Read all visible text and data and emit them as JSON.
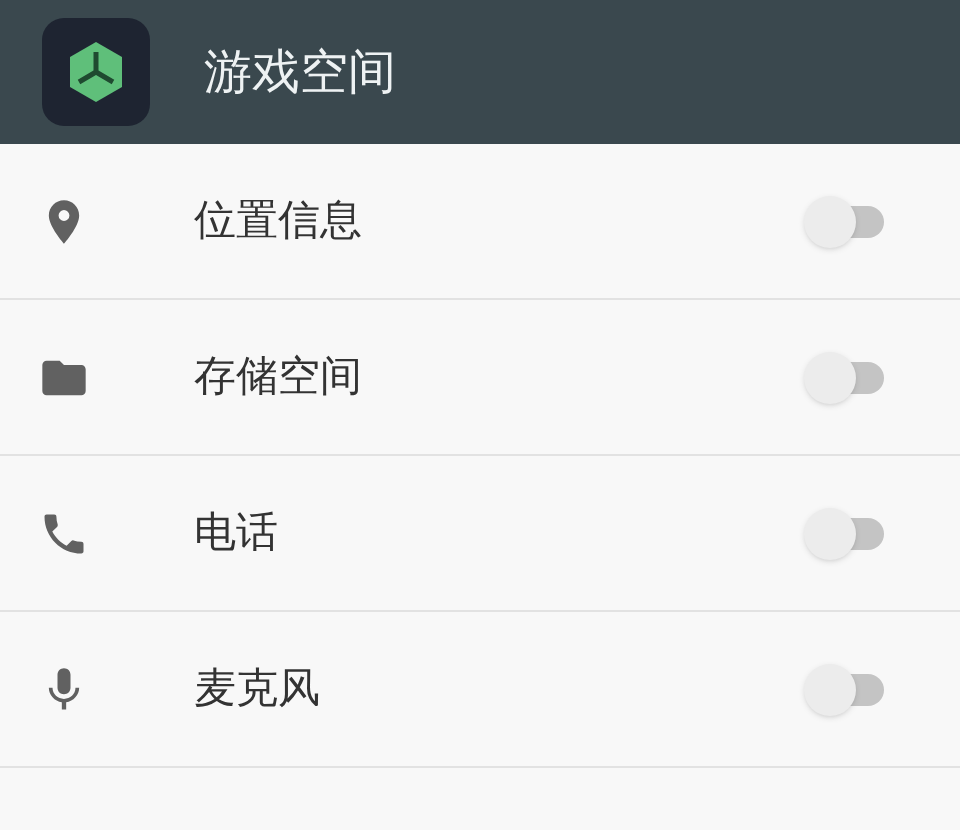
{
  "header": {
    "title": "游戏空间"
  },
  "permissions": [
    {
      "label": "位置信息",
      "on": false
    },
    {
      "label": "存储空间",
      "on": false
    },
    {
      "label": "电话",
      "on": false
    },
    {
      "label": "麦克风",
      "on": false
    }
  ]
}
